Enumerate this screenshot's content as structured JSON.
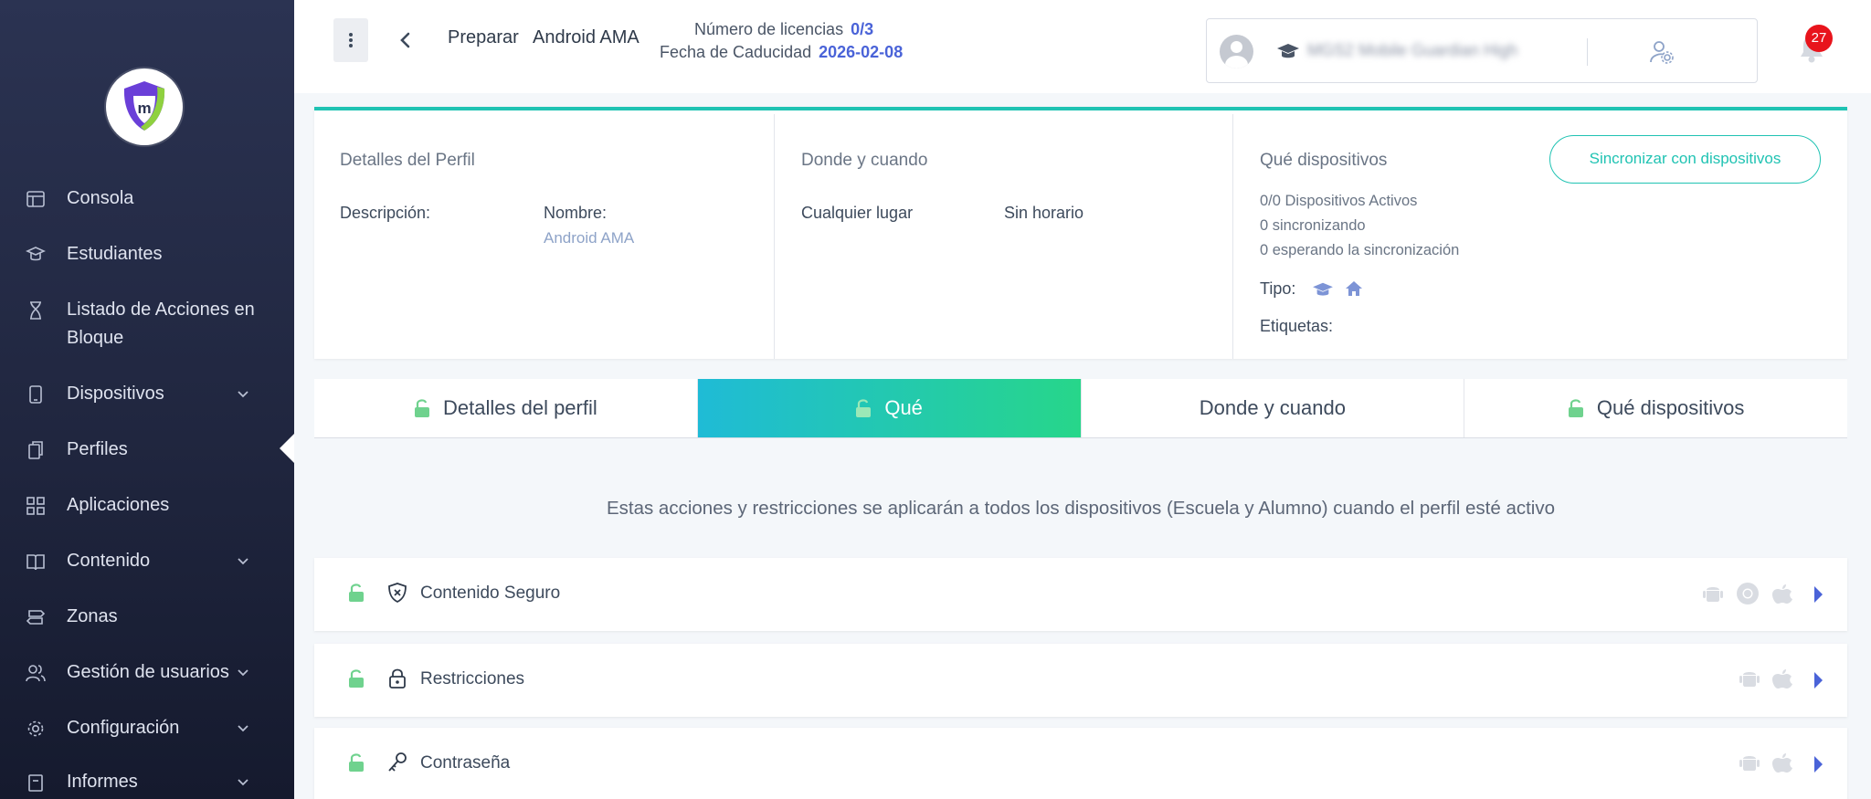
{
  "sidebar": {
    "items": [
      {
        "label": "Consola",
        "icon": "dashboard-icon"
      },
      {
        "label": "Estudiantes",
        "icon": "student-icon"
      },
      {
        "label": "Listado de Acciones en Bloque",
        "icon": "hourglass-icon"
      },
      {
        "label": "Dispositivos",
        "icon": "device-icon",
        "expandable": true
      },
      {
        "label": "Perfiles",
        "icon": "profiles-icon"
      },
      {
        "label": "Aplicaciones",
        "icon": "apps-grid-icon"
      },
      {
        "label": "Contenido",
        "icon": "book-icon",
        "expandable": true
      },
      {
        "label": "Zonas",
        "icon": "signpost-icon"
      },
      {
        "label": "Gestión de usuarios",
        "icon": "users-icon",
        "expandable": true
      },
      {
        "label": "Configuración",
        "icon": "gear-icon",
        "expandable": true
      },
      {
        "label": "Informes",
        "icon": "report-icon",
        "expandable": true
      }
    ]
  },
  "header": {
    "crumb_prepare": "Preparar",
    "crumb_profile": "Android AMA",
    "licenses_label": "Número de licencias",
    "licenses_value": "0/3",
    "expiry_label": "Fecha de Caducidad",
    "expiry_value": "2026-02-08",
    "school_name": "MGS2 Mobile Guardian High",
    "notifications_count": "27"
  },
  "summary": {
    "details_title": "Detalles del Perfil",
    "description_label": "Descripción:",
    "name_label": "Nombre:",
    "name_value": "Android AMA",
    "where_title": "Donde y cuando",
    "where_value": "Cualquier lugar",
    "when_value": "Sin horario",
    "devices_title": "Qué dispositivos",
    "sync_button": "Sincronizar con dispositivos",
    "active_devices": "0/0 Dispositivos Activos",
    "syncing": "0 sincronizando",
    "waiting_sync": "0 esperando la sincronización",
    "type_label": "Tipo:",
    "tags_label": "Etiquetas:"
  },
  "tabs": [
    {
      "label": "Detalles del perfil",
      "locked_icon": true,
      "active": false
    },
    {
      "label": "Qué",
      "locked_icon": true,
      "active": true
    },
    {
      "label": "Donde y cuando",
      "locked_icon": false,
      "active": false
    },
    {
      "label": "Qué dispositivos",
      "locked_icon": true,
      "active": false
    }
  ],
  "info_text": "Estas acciones y restricciones se aplicarán a todos los dispositivos (Escuela y Alumno) cuando el perfil esté activo",
  "categories": [
    {
      "label": "Contenido Seguro",
      "icon": "shield-x-icon",
      "platforms": [
        "android",
        "chrome",
        "apple"
      ]
    },
    {
      "label": "Restricciones",
      "icon": "padlock-icon",
      "platforms": [
        "android",
        "apple"
      ]
    },
    {
      "label": "Contraseña",
      "icon": "key-icon",
      "platforms": [
        "android",
        "apple"
      ]
    }
  ],
  "colors": {
    "accent_teal": "#20c3b3",
    "accent_green": "#27d68a",
    "link_blue": "#4a63d8",
    "badge_red": "#e8141c",
    "lock_green": "#6fd28e"
  }
}
